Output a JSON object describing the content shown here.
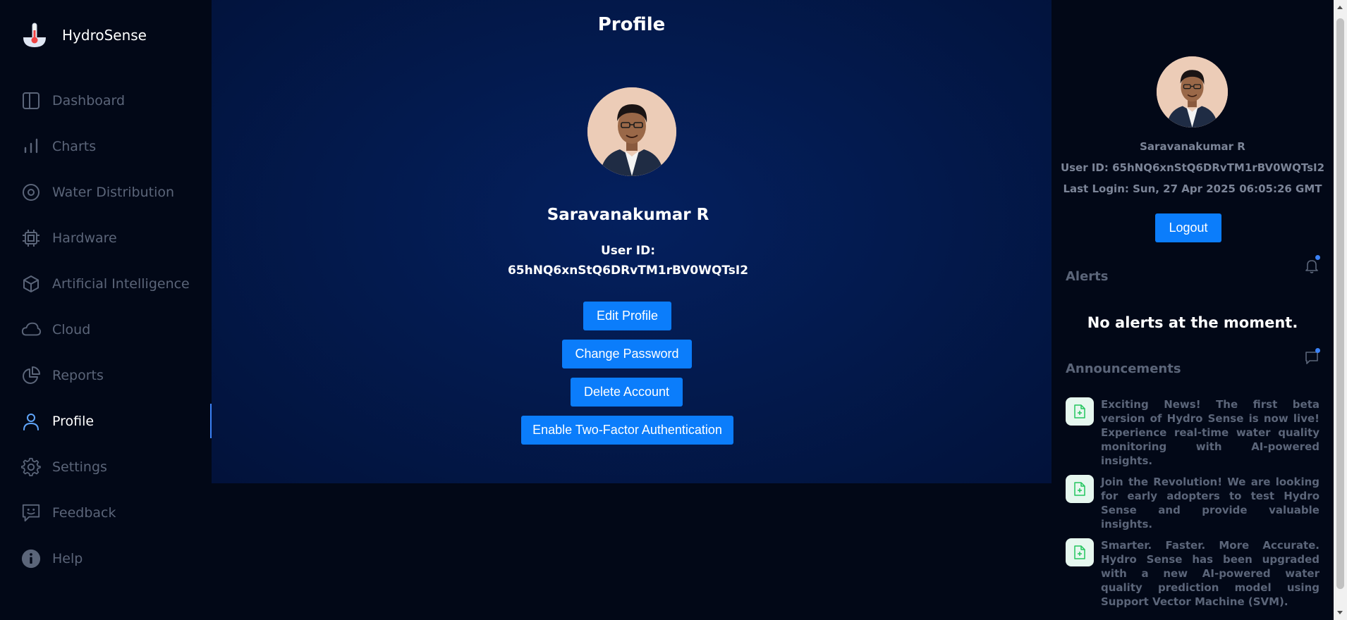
{
  "brand": {
    "name": "HydroSense"
  },
  "sidebar": {
    "items": [
      {
        "label": "Dashboard",
        "icon": "dashboard-icon"
      },
      {
        "label": "Charts",
        "icon": "chart-icon"
      },
      {
        "label": "Water Distribution",
        "icon": "target-icon"
      },
      {
        "label": "Hardware",
        "icon": "chip-icon"
      },
      {
        "label": "Artificial Intelligence",
        "icon": "cube-icon"
      },
      {
        "label": "Cloud",
        "icon": "cloud-icon"
      },
      {
        "label": "Reports",
        "icon": "pie-icon"
      },
      {
        "label": "Profile",
        "icon": "user-icon",
        "active": true
      },
      {
        "label": "Settings",
        "icon": "gear-icon"
      },
      {
        "label": "Feedback",
        "icon": "feedback-icon"
      },
      {
        "label": "Help",
        "icon": "info-icon"
      }
    ]
  },
  "main": {
    "title": "Profile",
    "name": "Saravanakumar R",
    "user_id_label": "User ID:",
    "user_id": "65hNQ6xnStQ6DRvTM1rBV0WQTsI2",
    "buttons": {
      "edit": "Edit Profile",
      "change_password": "Change Password",
      "delete": "Delete Account",
      "two_factor": "Enable Two-Factor Authentication"
    }
  },
  "right": {
    "name": "Saravanakumar R",
    "user_id": "User ID: 65hNQ6xnStQ6DRvTM1rBV0WQTsI2",
    "last_login": "Last Login: Sun, 27 Apr 2025 06:05:26 GMT",
    "logout": "Logout",
    "alerts_title": "Alerts",
    "no_alerts": "No alerts at the moment.",
    "announcements_title": "Announcements",
    "announcements": [
      "Exciting News! The first beta version of Hydro Sense is now live! Experience real-time water quality monitoring with AI-powered insights.",
      "Join the Revolution! We are looking for early adopters to test Hydro Sense and provide valuable insights.",
      "Smarter. Faster. More Accurate. Hydro Sense has been upgraded with a new AI-powered water quality prediction model using Support Vector Machine (SVM)."
    ]
  },
  "colors": {
    "accent": "#0b7dfb",
    "background": "#020817",
    "panel": "#031a4e",
    "muted": "#5b6579"
  }
}
